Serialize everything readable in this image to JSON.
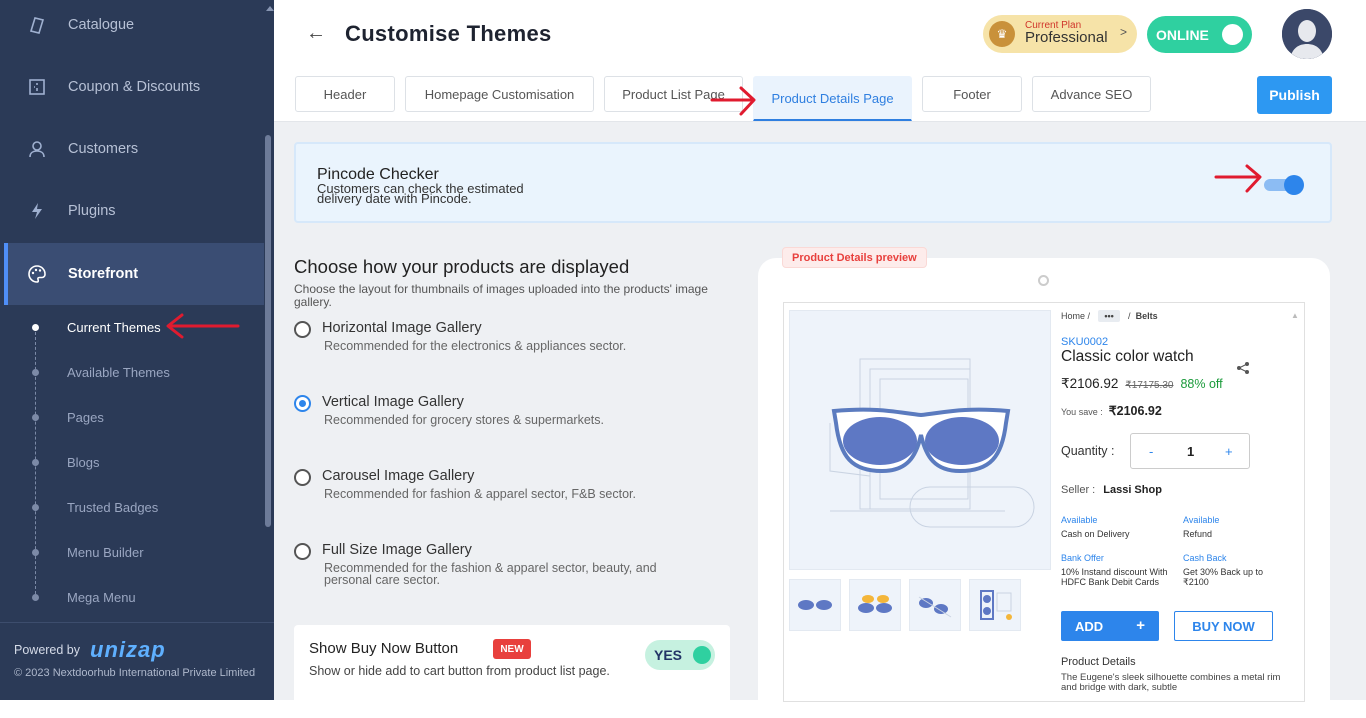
{
  "sidebar": {
    "items": [
      {
        "label": "Catalogue",
        "icon": "catalogue-icon"
      },
      {
        "label": "Coupon & Discounts",
        "icon": "coupon-icon"
      },
      {
        "label": "Customers",
        "icon": "user-icon"
      },
      {
        "label": "Plugins",
        "icon": "plugin-icon"
      },
      {
        "label": "Storefront",
        "icon": "palette-icon",
        "active": true
      }
    ],
    "subitems": [
      "Current Themes",
      "Available Themes",
      "Pages",
      "Blogs",
      "Trusted Badges",
      "Menu Builder",
      "Mega Menu"
    ],
    "powered_by": "Powered by",
    "logo": "unizap",
    "copyright": "© 2023 Nextdoorhub International Private Limited"
  },
  "header": {
    "title": "Customise Themes",
    "plan_small": "Current Plan",
    "plan_name": "Professional",
    "status": "ONLINE"
  },
  "tabs": [
    "Header",
    "Homepage Customisation",
    "Product List Page",
    "Product Details Page",
    "Footer",
    "Advance SEO"
  ],
  "active_tab": "Product Details Page",
  "publish_label": "Publish",
  "pincode": {
    "title": "Pincode Checker",
    "desc": "Customers can check the estimated delivery date with Pincode.",
    "enabled": true
  },
  "display": {
    "title": "Choose how your products are displayed",
    "desc": "Choose the layout for thumbnails of images uploaded into the products' image gallery.",
    "options": [
      {
        "label": "Horizontal Image Gallery",
        "desc": "Recommended for the electronics & appliances sector."
      },
      {
        "label": "Vertical Image Gallery",
        "desc": "Recommended for grocery stores & supermarkets."
      },
      {
        "label": "Carousel Image Gallery",
        "desc": "Recommended for fashion & apparel sector, F&B sector."
      },
      {
        "label": "Full Size Image Gallery",
        "desc": "Recommended for the fashion & apparel sector, beauty, and personal care sector."
      }
    ],
    "selected": "Vertical Image Gallery"
  },
  "buy_now": {
    "title": "Show Buy Now Button",
    "badge": "NEW",
    "desc": "Show or hide add to cart button from product list page.",
    "toggle": "YES"
  },
  "preview": {
    "label": "Product Details preview",
    "breadcrumb": [
      "Home",
      "/",
      "•••",
      "/",
      "Belts"
    ],
    "sku": "SKU0002",
    "name": "Classic color watch",
    "price": "₹2106.92",
    "mrp": "₹17175.30",
    "off": "88% off",
    "save_label": "You save :",
    "save_value": "₹2106.92",
    "qty_label": "Quantity :",
    "qty_minus": "-",
    "qty_value": "1",
    "qty_plus": "+",
    "seller_label": "Seller :",
    "seller_name": "Lassi Shop",
    "info": [
      {
        "h": "Available",
        "t": "Cash on Delivery"
      },
      {
        "h": "Available",
        "t": "Refund"
      },
      {
        "h": "Bank Offer",
        "t": "10% Instand discount With HDFC Bank Debit Cards"
      },
      {
        "h": "Cash Back",
        "t": "Get 30% Back up to ₹2100"
      }
    ],
    "add_label": "ADD",
    "add_plus": "+",
    "buy_label": "BUY NOW",
    "details_title": "Product Details",
    "details_desc": "The Eugene's sleek silhouette combines a metal rim and bridge with dark, subtle"
  }
}
